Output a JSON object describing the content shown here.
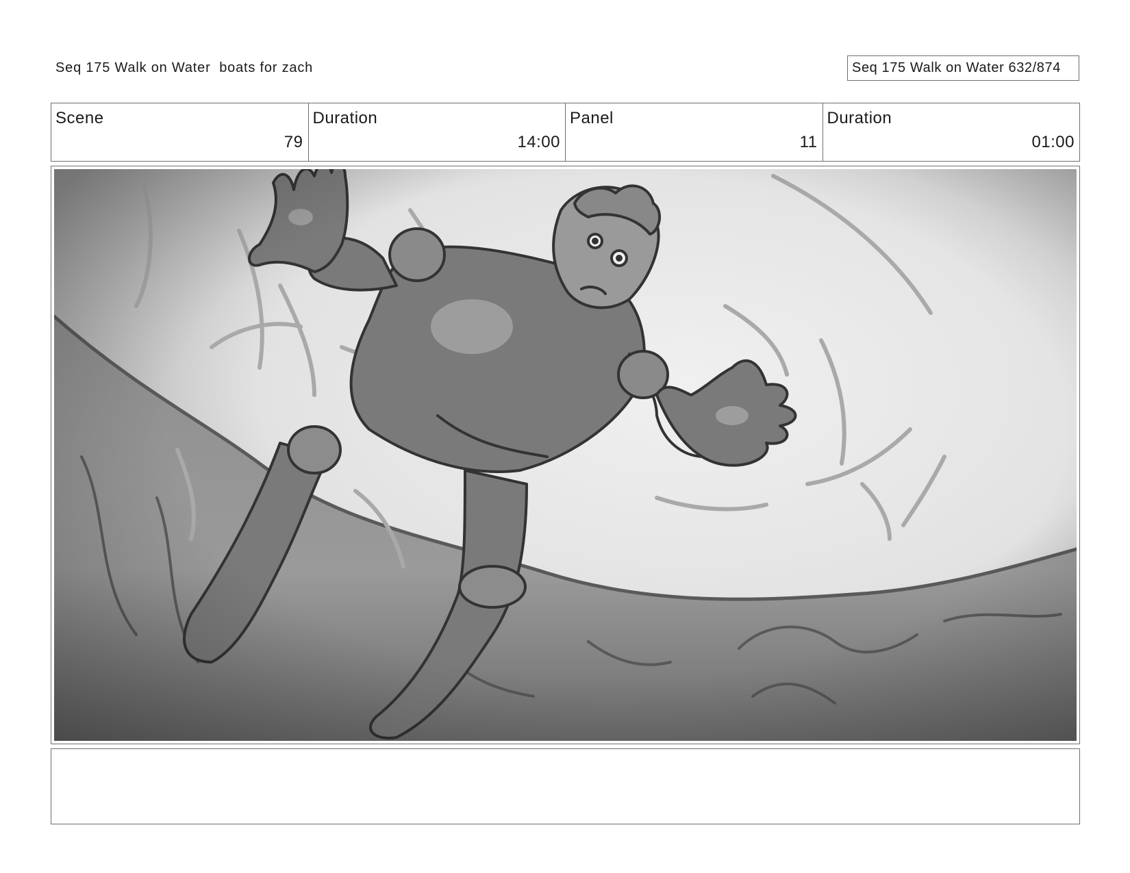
{
  "header": {
    "title": "Seq 175 Walk on Water  boats for zach",
    "page_counter": "Seq 175 Walk on Water 632/874"
  },
  "info": {
    "scene_label": "Scene",
    "scene_value": "79",
    "scene_duration_label": "Duration",
    "scene_duration_value": "14:00",
    "panel_label": "Panel",
    "panel_value": "11",
    "panel_duration_label": "Duration",
    "panel_duration_value": "01:00"
  },
  "panel": {
    "image_subject": "figure-falling-into-water-sketch"
  },
  "notes": {
    "text": ""
  },
  "colors": {
    "border": "#6e6e6e",
    "sky_light": "#eeeeee",
    "water_mid": "#9a9a9a",
    "figure_tone": "#7a7a7a",
    "line_dark": "#333333"
  }
}
